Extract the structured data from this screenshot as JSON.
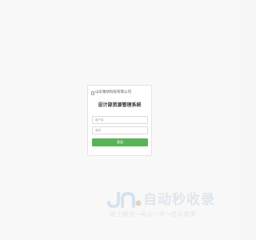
{
  "login": {
    "logo_alt": "山东潍坊科技有限公司",
    "title": "设计部资源管理系统",
    "username_placeholder": "用户名",
    "password_placeholder": "密码",
    "submit_label": "登录"
  },
  "watermark": {
    "title": "自动秒收录",
    "subtitle": "放上链接→来访一次→自动收录"
  },
  "colors": {
    "button": "#58b456",
    "background": "#f8f8f8",
    "card": "#ffffff"
  }
}
